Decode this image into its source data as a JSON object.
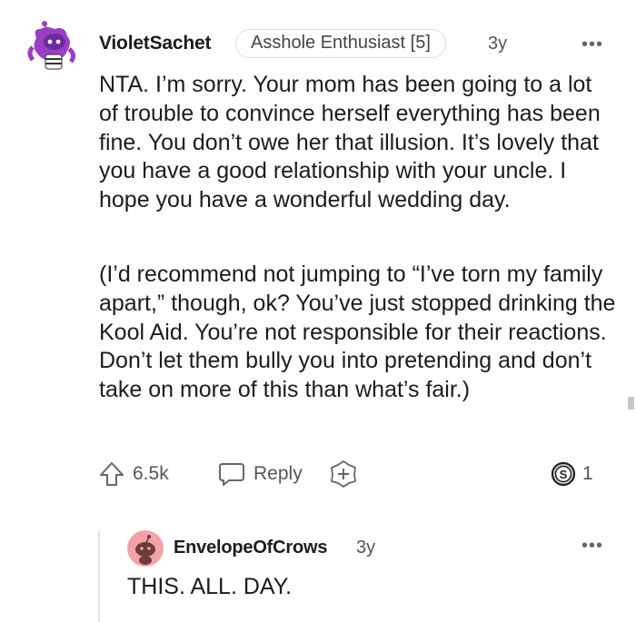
{
  "comment": {
    "username": "VioletSachet",
    "flair": "Asshole Enthusiast [5]",
    "age": "3y",
    "more": "•••",
    "paragraphs": [
      "NTA. I’m sorry. Your mom has been going to a lot of trouble to convince herself everything has been fine. You don’t owe her that illusion. It’s lovely that you have a good relationship with your uncle. I hope you have a wonderful wedding day.",
      "(I’d recommend not jumping to “I’ve torn my family apart,” though, ok? You’ve just stopped drinking the Kool Aid. You’re not responsible for their reactions. Don’t let them bully you into pretending and don’t take on more of this than what’s fair.)"
    ],
    "actions": {
      "upvotes": "6.5k",
      "reply_label": "Reply",
      "award_count": "1"
    }
  },
  "reply": {
    "username": "EnvelopeOfCrows",
    "age": "3y",
    "more": "•••",
    "text": "THIS. ALL. DAY."
  },
  "colors": {
    "avatar_purple": "#9a3fc2",
    "reply_avatar_bg": "#f2a3a8",
    "text": "#1c1c1c",
    "muted": "#555555"
  }
}
